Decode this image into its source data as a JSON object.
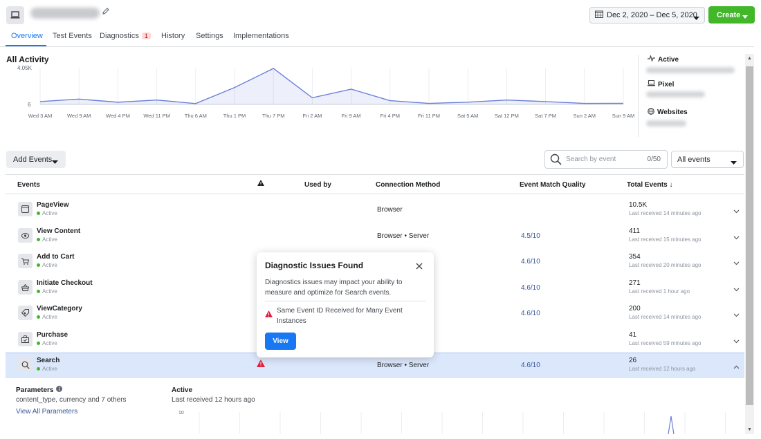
{
  "header": {
    "date_range": "Dec 2, 2020 – Dec 5, 2020",
    "create_label": "Create"
  },
  "tabs": [
    {
      "label": "Overview"
    },
    {
      "label": "Test Events"
    },
    {
      "label": "Diagnostics",
      "badge": "1"
    },
    {
      "label": "History"
    },
    {
      "label": "Settings"
    },
    {
      "label": "Implementations"
    }
  ],
  "activity": {
    "title": "All Activity",
    "side": [
      {
        "label": "Active",
        "icon": "activity-icon"
      },
      {
        "label": "Pixel",
        "icon": "laptop-icon"
      },
      {
        "label": "Websites",
        "icon": "globe-icon"
      }
    ]
  },
  "chart_data": {
    "type": "area",
    "title": "All Activity",
    "x": [
      "Wed 3 AM",
      "Wed 9 AM",
      "Wed 4 PM",
      "Wed 11 PM",
      "Thu 6 AM",
      "Thu 1 PM",
      "Thu 7 PM",
      "Fri 2 AM",
      "Fri 9 AM",
      "Fri 4 PM",
      "Fri 11 PM",
      "Sat 5 AM",
      "Sat 12 PM",
      "Sat 7 PM",
      "Sun 2 AM",
      "Sun 9 AM"
    ],
    "series": [
      {
        "values": [
          320,
          600,
          250,
          500,
          100,
          1900,
          4050,
          750,
          1720,
          430,
          120,
          250,
          500,
          320,
          120,
          130
        ]
      }
    ],
    "yticks": [
      "4.05K",
      "6"
    ],
    "ylim": [
      6,
      4050
    ],
    "color": "#6b7fd8"
  },
  "controls": {
    "add_events": "Add Events",
    "search_placeholder": "Search by event",
    "search_count": "0/50",
    "filter_value": "All events"
  },
  "table": {
    "headers": {
      "events": "Events",
      "used_by": "Used by",
      "connection": "Connection Method",
      "quality": "Event Match Quality",
      "total": "Total Events ↓"
    },
    "rows": [
      {
        "name": "PageView",
        "status": "Active",
        "connection": "Browser",
        "quality": "",
        "total": "10.5K",
        "last": "Last received 14 minutes ago",
        "icon": "page-icon"
      },
      {
        "name": "View Content",
        "status": "Active",
        "connection": "Browser • Server",
        "quality": "4.5/10",
        "total": "411",
        "last": "Last received 15 minutes ago",
        "icon": "eye-icon"
      },
      {
        "name": "Add to Cart",
        "status": "Active",
        "connection": "",
        "quality": "4.6/10",
        "total": "354",
        "last": "Last received 20 minutes ago",
        "icon": "cart-icon"
      },
      {
        "name": "Initiate Checkout",
        "status": "Active",
        "connection": "",
        "quality": "4.6/10",
        "total": "271",
        "last": "Last received 1 hour ago",
        "icon": "basket-icon"
      },
      {
        "name": "ViewCategory",
        "status": "Active",
        "connection": "",
        "quality": "4.6/10",
        "total": "200",
        "last": "Last received 14 minutes ago",
        "icon": "tag-icon"
      },
      {
        "name": "Purchase",
        "status": "Active",
        "connection": "",
        "quality": "",
        "total": "41",
        "last": "Last received 59 minutes ago",
        "icon": "bag-icon"
      },
      {
        "name": "Search",
        "status": "Active",
        "connection": "Browser • Server",
        "quality": "4.6/10",
        "total": "26",
        "last": "Last received 12 hours ago",
        "icon": "search-icon"
      }
    ]
  },
  "details": {
    "params_title": "Parameters",
    "params_value": "content_type, currency and 7 others",
    "view_all": "View All Parameters",
    "active_title": "Active",
    "active_last": "Last received 12 hours ago",
    "mini_ytick": "10"
  },
  "popup": {
    "title": "Diagnostic Issues Found",
    "description": "Diagnostics issues may impact your ability to measure and optimize for Search events.",
    "issue": "Same Event ID Received for Many Event Instances",
    "view_label": "View"
  }
}
